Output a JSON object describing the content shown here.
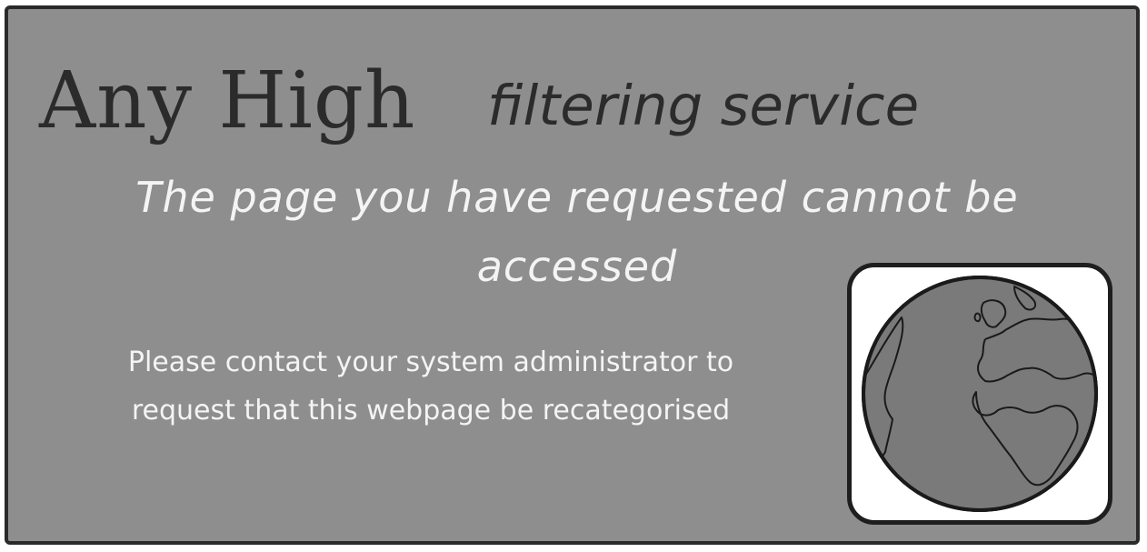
{
  "header": {
    "brand": "Any High",
    "service": "filtering service"
  },
  "headline": {
    "line1": "The page you have requested cannot be",
    "line2": "accessed"
  },
  "message": {
    "line1": "Please contact your system administrator to",
    "line2": "request that this webpage be recategorised"
  },
  "icon": {
    "name": "globe-icon"
  },
  "colors": {
    "background": "#8e8e8e",
    "border": "#2a2a2a",
    "heading_text": "#2b2b2b",
    "body_text": "#f4f4f4",
    "globe_fill": "#7a7a7a",
    "icon_box": "#ffffff"
  }
}
